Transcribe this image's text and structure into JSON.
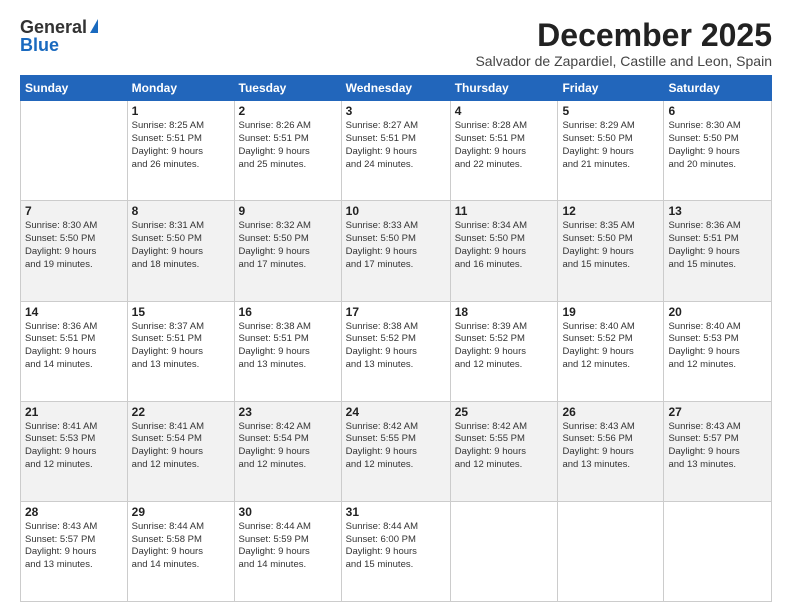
{
  "logo": {
    "line1": "General",
    "line2": "Blue"
  },
  "title": "December 2025",
  "location": "Salvador de Zapardiel, Castille and Leon, Spain",
  "days_of_week": [
    "Sunday",
    "Monday",
    "Tuesday",
    "Wednesday",
    "Thursday",
    "Friday",
    "Saturday"
  ],
  "weeks": [
    [
      {
        "day": "",
        "info": ""
      },
      {
        "day": "1",
        "info": "Sunrise: 8:25 AM\nSunset: 5:51 PM\nDaylight: 9 hours\nand 26 minutes."
      },
      {
        "day": "2",
        "info": "Sunrise: 8:26 AM\nSunset: 5:51 PM\nDaylight: 9 hours\nand 25 minutes."
      },
      {
        "day": "3",
        "info": "Sunrise: 8:27 AM\nSunset: 5:51 PM\nDaylight: 9 hours\nand 24 minutes."
      },
      {
        "day": "4",
        "info": "Sunrise: 8:28 AM\nSunset: 5:51 PM\nDaylight: 9 hours\nand 22 minutes."
      },
      {
        "day": "5",
        "info": "Sunrise: 8:29 AM\nSunset: 5:50 PM\nDaylight: 9 hours\nand 21 minutes."
      },
      {
        "day": "6",
        "info": "Sunrise: 8:30 AM\nSunset: 5:50 PM\nDaylight: 9 hours\nand 20 minutes."
      }
    ],
    [
      {
        "day": "7",
        "info": "Sunrise: 8:30 AM\nSunset: 5:50 PM\nDaylight: 9 hours\nand 19 minutes."
      },
      {
        "day": "8",
        "info": "Sunrise: 8:31 AM\nSunset: 5:50 PM\nDaylight: 9 hours\nand 18 minutes."
      },
      {
        "day": "9",
        "info": "Sunrise: 8:32 AM\nSunset: 5:50 PM\nDaylight: 9 hours\nand 17 minutes."
      },
      {
        "day": "10",
        "info": "Sunrise: 8:33 AM\nSunset: 5:50 PM\nDaylight: 9 hours\nand 17 minutes."
      },
      {
        "day": "11",
        "info": "Sunrise: 8:34 AM\nSunset: 5:50 PM\nDaylight: 9 hours\nand 16 minutes."
      },
      {
        "day": "12",
        "info": "Sunrise: 8:35 AM\nSunset: 5:50 PM\nDaylight: 9 hours\nand 15 minutes."
      },
      {
        "day": "13",
        "info": "Sunrise: 8:36 AM\nSunset: 5:51 PM\nDaylight: 9 hours\nand 15 minutes."
      }
    ],
    [
      {
        "day": "14",
        "info": "Sunrise: 8:36 AM\nSunset: 5:51 PM\nDaylight: 9 hours\nand 14 minutes."
      },
      {
        "day": "15",
        "info": "Sunrise: 8:37 AM\nSunset: 5:51 PM\nDaylight: 9 hours\nand 13 minutes."
      },
      {
        "day": "16",
        "info": "Sunrise: 8:38 AM\nSunset: 5:51 PM\nDaylight: 9 hours\nand 13 minutes."
      },
      {
        "day": "17",
        "info": "Sunrise: 8:38 AM\nSunset: 5:52 PM\nDaylight: 9 hours\nand 13 minutes."
      },
      {
        "day": "18",
        "info": "Sunrise: 8:39 AM\nSunset: 5:52 PM\nDaylight: 9 hours\nand 12 minutes."
      },
      {
        "day": "19",
        "info": "Sunrise: 8:40 AM\nSunset: 5:52 PM\nDaylight: 9 hours\nand 12 minutes."
      },
      {
        "day": "20",
        "info": "Sunrise: 8:40 AM\nSunset: 5:53 PM\nDaylight: 9 hours\nand 12 minutes."
      }
    ],
    [
      {
        "day": "21",
        "info": "Sunrise: 8:41 AM\nSunset: 5:53 PM\nDaylight: 9 hours\nand 12 minutes."
      },
      {
        "day": "22",
        "info": "Sunrise: 8:41 AM\nSunset: 5:54 PM\nDaylight: 9 hours\nand 12 minutes."
      },
      {
        "day": "23",
        "info": "Sunrise: 8:42 AM\nSunset: 5:54 PM\nDaylight: 9 hours\nand 12 minutes."
      },
      {
        "day": "24",
        "info": "Sunrise: 8:42 AM\nSunset: 5:55 PM\nDaylight: 9 hours\nand 12 minutes."
      },
      {
        "day": "25",
        "info": "Sunrise: 8:42 AM\nSunset: 5:55 PM\nDaylight: 9 hours\nand 12 minutes."
      },
      {
        "day": "26",
        "info": "Sunrise: 8:43 AM\nSunset: 5:56 PM\nDaylight: 9 hours\nand 13 minutes."
      },
      {
        "day": "27",
        "info": "Sunrise: 8:43 AM\nSunset: 5:57 PM\nDaylight: 9 hours\nand 13 minutes."
      }
    ],
    [
      {
        "day": "28",
        "info": "Sunrise: 8:43 AM\nSunset: 5:57 PM\nDaylight: 9 hours\nand 13 minutes."
      },
      {
        "day": "29",
        "info": "Sunrise: 8:44 AM\nSunset: 5:58 PM\nDaylight: 9 hours\nand 14 minutes."
      },
      {
        "day": "30",
        "info": "Sunrise: 8:44 AM\nSunset: 5:59 PM\nDaylight: 9 hours\nand 14 minutes."
      },
      {
        "day": "31",
        "info": "Sunrise: 8:44 AM\nSunset: 6:00 PM\nDaylight: 9 hours\nand 15 minutes."
      },
      {
        "day": "",
        "info": ""
      },
      {
        "day": "",
        "info": ""
      },
      {
        "day": "",
        "info": ""
      }
    ]
  ]
}
